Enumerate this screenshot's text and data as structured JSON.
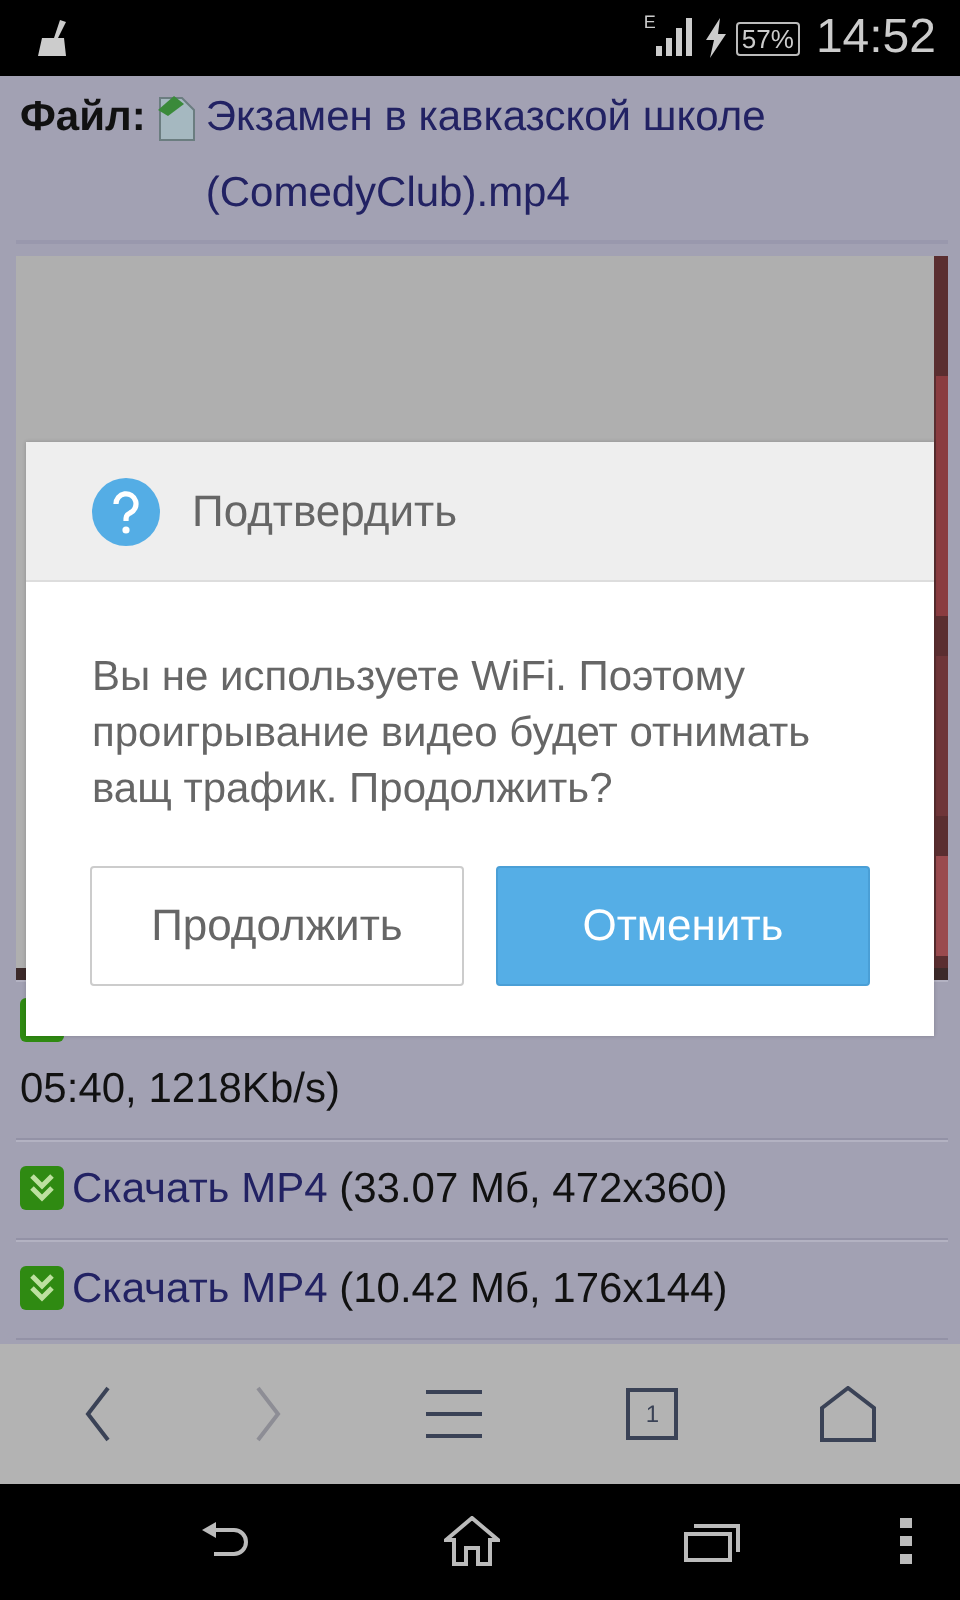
{
  "status_bar": {
    "network": "E",
    "battery": "57%",
    "time": "14:52"
  },
  "file": {
    "label": "Файл:",
    "name": "Экзамен в кавказской школе (ComedyClub).mp4"
  },
  "stream_info": "05:40, 1218Kb/s)",
  "downloads": [
    {
      "link": "Скачать MP4",
      "details": "(33.07 Мб, 472x360)"
    },
    {
      "link": "Скачать MP4",
      "details": "(10.42 Мб, 176x144)"
    }
  ],
  "toolbar": [
    {
      "kind": "back",
      "disabled": false
    },
    {
      "kind": "forward",
      "disabled": true
    },
    {
      "kind": "menu",
      "disabled": false
    },
    {
      "kind": "tabs",
      "count": "1",
      "disabled": false
    },
    {
      "kind": "home",
      "disabled": false
    }
  ],
  "dialog": {
    "title": "Подтвердить",
    "message": "Вы не используете WiFi. Поэтому проигрывание видео будет отнимать ващ трафик. Продолжить?",
    "buttons": [
      {
        "label": "Продолжить",
        "primary": false
      },
      {
        "label": "Отменить",
        "primary": true
      }
    ]
  }
}
